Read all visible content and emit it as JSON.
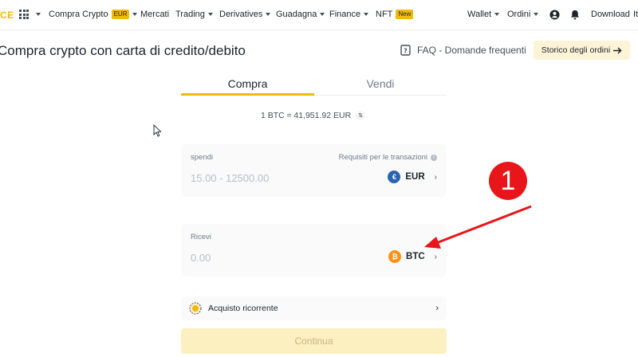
{
  "nav": {
    "logo": "CE",
    "items": [
      {
        "label": "Compra Crypto",
        "badge": "EUR",
        "caret": true
      },
      {
        "label": "Mercati",
        "caret": false
      },
      {
        "label": "Trading",
        "caret": true
      },
      {
        "label": "Derivatives",
        "caret": true
      },
      {
        "label": "Guadagna",
        "caret": true
      },
      {
        "label": "Finance",
        "caret": true
      },
      {
        "label": "NFT",
        "badge": "New",
        "caret": false
      }
    ],
    "right": {
      "wallet": "Wallet",
      "orders": "Ordini",
      "download": "Download",
      "lang": "It"
    }
  },
  "header": {
    "title": "Compra crypto con carta di credito/debito",
    "faq": "FAQ - Domande frequenti",
    "history": "Storico degli ordini"
  },
  "tabs": {
    "buy": "Compra",
    "sell": "Vendi"
  },
  "rate": {
    "text": "1 BTC ≈ 41,951.92 EUR"
  },
  "spend": {
    "label": "spendi",
    "requirements": "Requisiti per le transazioni",
    "placeholder": "15.00 - 12500.00",
    "currency": "EUR"
  },
  "receive": {
    "label": "Ricevi",
    "placeholder": "0.00",
    "currency": "BTC"
  },
  "recurring": {
    "label": "Acquisto ricorrente"
  },
  "continue": {
    "label": "Continua"
  },
  "annotation": {
    "number": "1",
    "color": "#e8161a"
  },
  "colors": {
    "accent": "#f0b90b",
    "text": "#1e2329",
    "muted": "#707a8a"
  }
}
